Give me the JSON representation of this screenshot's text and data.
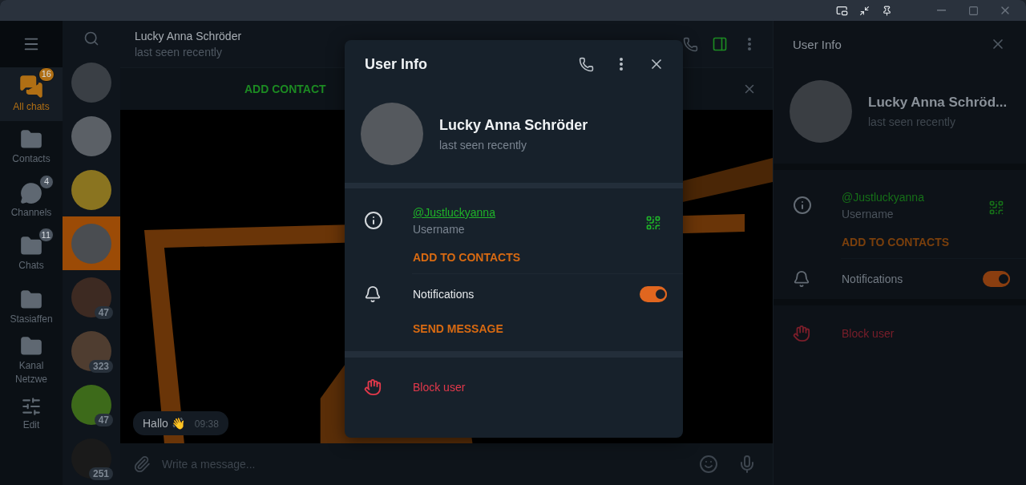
{
  "folders": [
    {
      "kind": "chats",
      "label": "All chats",
      "badge": "16",
      "selected": true
    },
    {
      "kind": "folder",
      "label": "Contacts",
      "selected": false
    },
    {
      "kind": "channels",
      "label": "Channels",
      "badge": "4",
      "selected": false
    },
    {
      "kind": "folder",
      "label": "Chats",
      "badge": "11",
      "selected": false
    },
    {
      "kind": "folder",
      "label": "Stasiaffen",
      "selected": false
    },
    {
      "kind": "folder",
      "label": "Kanal Netzwe",
      "selected": false
    },
    {
      "kind": "edit",
      "label": "Edit",
      "selected": false
    }
  ],
  "chats": [
    {
      "selected": false
    },
    {
      "selected": false
    },
    {
      "selected": false
    },
    {
      "selected": true
    },
    {
      "badge": "47",
      "selected": false
    },
    {
      "badge": "323",
      "selected": false
    },
    {
      "badge": "47",
      "selected": false
    },
    {
      "badge": "251",
      "selected": false
    }
  ],
  "chat": {
    "name": "Lucky Anna Schröder",
    "status": "last seen recently",
    "add_contact": "ADD CONTACT",
    "messages": [
      {
        "text": "Hallo 👋",
        "time": "09:38"
      }
    ],
    "composer": {
      "placeholder": "Write a message..."
    }
  },
  "side_panel": {
    "title": "User Info",
    "name": "Lucky Anna Schröd...",
    "status": "last seen recently",
    "username": "@Justluckyanna",
    "username_label": "Username",
    "add_to_contacts": "ADD TO CONTACTS",
    "notifications": "Notifications",
    "notifications_on": true,
    "block": "Block user"
  },
  "dialog": {
    "title": "User Info",
    "name": "Lucky Anna Schröder",
    "status": "last seen recently",
    "username": "@Justluckyanna",
    "username_label": "Username",
    "add_to_contacts": "ADD TO CONTACTS",
    "notifications": "Notifications",
    "notifications_on": true,
    "send_message": "SEND MESSAGE",
    "block": "Block user"
  }
}
